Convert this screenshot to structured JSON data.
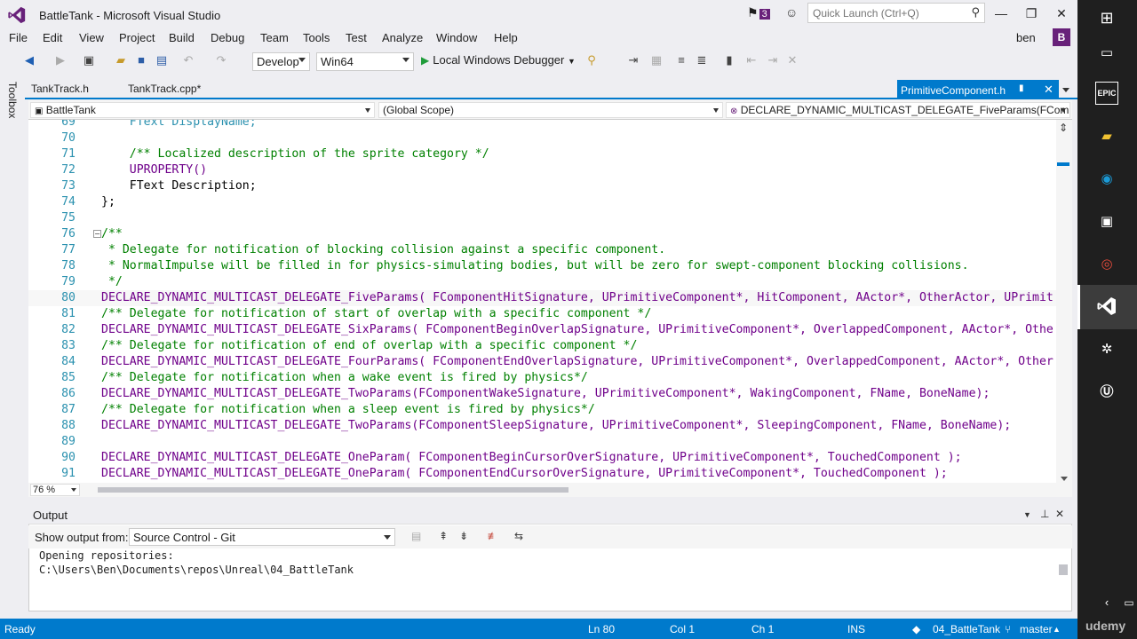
{
  "window": {
    "title": "BattleTank - Microsoft Visual Studio",
    "notification_count": "3",
    "quick_launch_placeholder": "Quick Launch (Ctrl+Q)"
  },
  "menu": [
    "File",
    "Edit",
    "View",
    "Project",
    "Build",
    "Debug",
    "Team",
    "Tools",
    "Test",
    "Analyze",
    "Window",
    "Help"
  ],
  "user": {
    "name": "ben",
    "initial": "B"
  },
  "toolbar": {
    "configuration": "Develop",
    "platform": "Win64",
    "debugger": "Local Windows Debugger"
  },
  "toolbox_label": "Toolbox",
  "tabs": {
    "tab1": "TankTrack.h",
    "tab2": "TankTrack.cpp*",
    "active": "PrimitiveComponent.h"
  },
  "nav": {
    "project": "BattleTank",
    "scope": "(Global Scope)",
    "member": "DECLARE_DYNAMIC_MULTICAST_DELEGATE_FiveParams(FComponentHitSignature"
  },
  "code_lines": [
    {
      "n": "69",
      "t": "    FText DisplayName;"
    },
    {
      "n": "70",
      "t": ""
    },
    {
      "n": "71",
      "t": "    /** Localized description of the sprite category */"
    },
    {
      "n": "72",
      "t": "    UPROPERTY()"
    },
    {
      "n": "73",
      "t": "    FText Description;"
    },
    {
      "n": "74",
      "t": "};"
    },
    {
      "n": "75",
      "t": ""
    },
    {
      "n": "76",
      "t": "/**"
    },
    {
      "n": "77",
      "t": " * Delegate for notification of blocking collision against a specific component."
    },
    {
      "n": "78",
      "t": " * NormalImpulse will be filled in for physics-simulating bodies, but will be zero for swept-component blocking collisions."
    },
    {
      "n": "79",
      "t": " */"
    },
    {
      "n": "80",
      "t": "DECLARE_DYNAMIC_MULTICAST_DELEGATE_FiveParams( FComponentHitSignature, UPrimitiveComponent*, HitComponent, AActor*, OtherActor, UPrimit"
    },
    {
      "n": "81",
      "t": "/** Delegate for notification of start of overlap with a specific component */"
    },
    {
      "n": "82",
      "t": "DECLARE_DYNAMIC_MULTICAST_DELEGATE_SixParams( FComponentBeginOverlapSignature, UPrimitiveComponent*, OverlappedComponent, AActor*, Othe"
    },
    {
      "n": "83",
      "t": "/** Delegate for notification of end of overlap with a specific component */"
    },
    {
      "n": "84",
      "t": "DECLARE_DYNAMIC_MULTICAST_DELEGATE_FourParams( FComponentEndOverlapSignature, UPrimitiveComponent*, OverlappedComponent, AActor*, Other"
    },
    {
      "n": "85",
      "t": "/** Delegate for notification when a wake event is fired by physics*/"
    },
    {
      "n": "86",
      "t": "DECLARE_DYNAMIC_MULTICAST_DELEGATE_TwoParams(FComponentWakeSignature, UPrimitiveComponent*, WakingComponent, FName, BoneName);"
    },
    {
      "n": "87",
      "t": "/** Delegate for notification when a sleep event is fired by physics*/"
    },
    {
      "n": "88",
      "t": "DECLARE_DYNAMIC_MULTICAST_DELEGATE_TwoParams(FComponentSleepSignature, UPrimitiveComponent*, SleepingComponent, FName, BoneName);"
    },
    {
      "n": "89",
      "t": ""
    },
    {
      "n": "90",
      "t": "DECLARE_DYNAMIC_MULTICAST_DELEGATE_OneParam( FComponentBeginCursorOverSignature, UPrimitiveComponent*, TouchedComponent );"
    },
    {
      "n": "91",
      "t": "DECLARE_DYNAMIC_MULTICAST_DELEGATE_OneParam( FComponentEndCursorOverSignature, UPrimitiveComponent*, TouchedComponent );"
    }
  ],
  "editor": {
    "zoom": "76 %"
  },
  "output": {
    "title": "Output",
    "show_from_label": "Show output from:",
    "source": "Source Control - Git",
    "lines": [
      "Opening repositories:",
      "C:\\Users\\Ben\\Documents\\repos\\Unreal\\04_BattleTank"
    ]
  },
  "status": {
    "ready": "Ready",
    "ln": "Ln 80",
    "col": "Col 1",
    "ch": "Ch 1",
    "ins": "INS",
    "repo": "04_BattleTank",
    "branch": "master"
  },
  "watermark": "udemy",
  "colors": {
    "accent": "#007acc",
    "vs_purple": "#68217a",
    "comment": "#008000",
    "type": "#2b91af"
  }
}
